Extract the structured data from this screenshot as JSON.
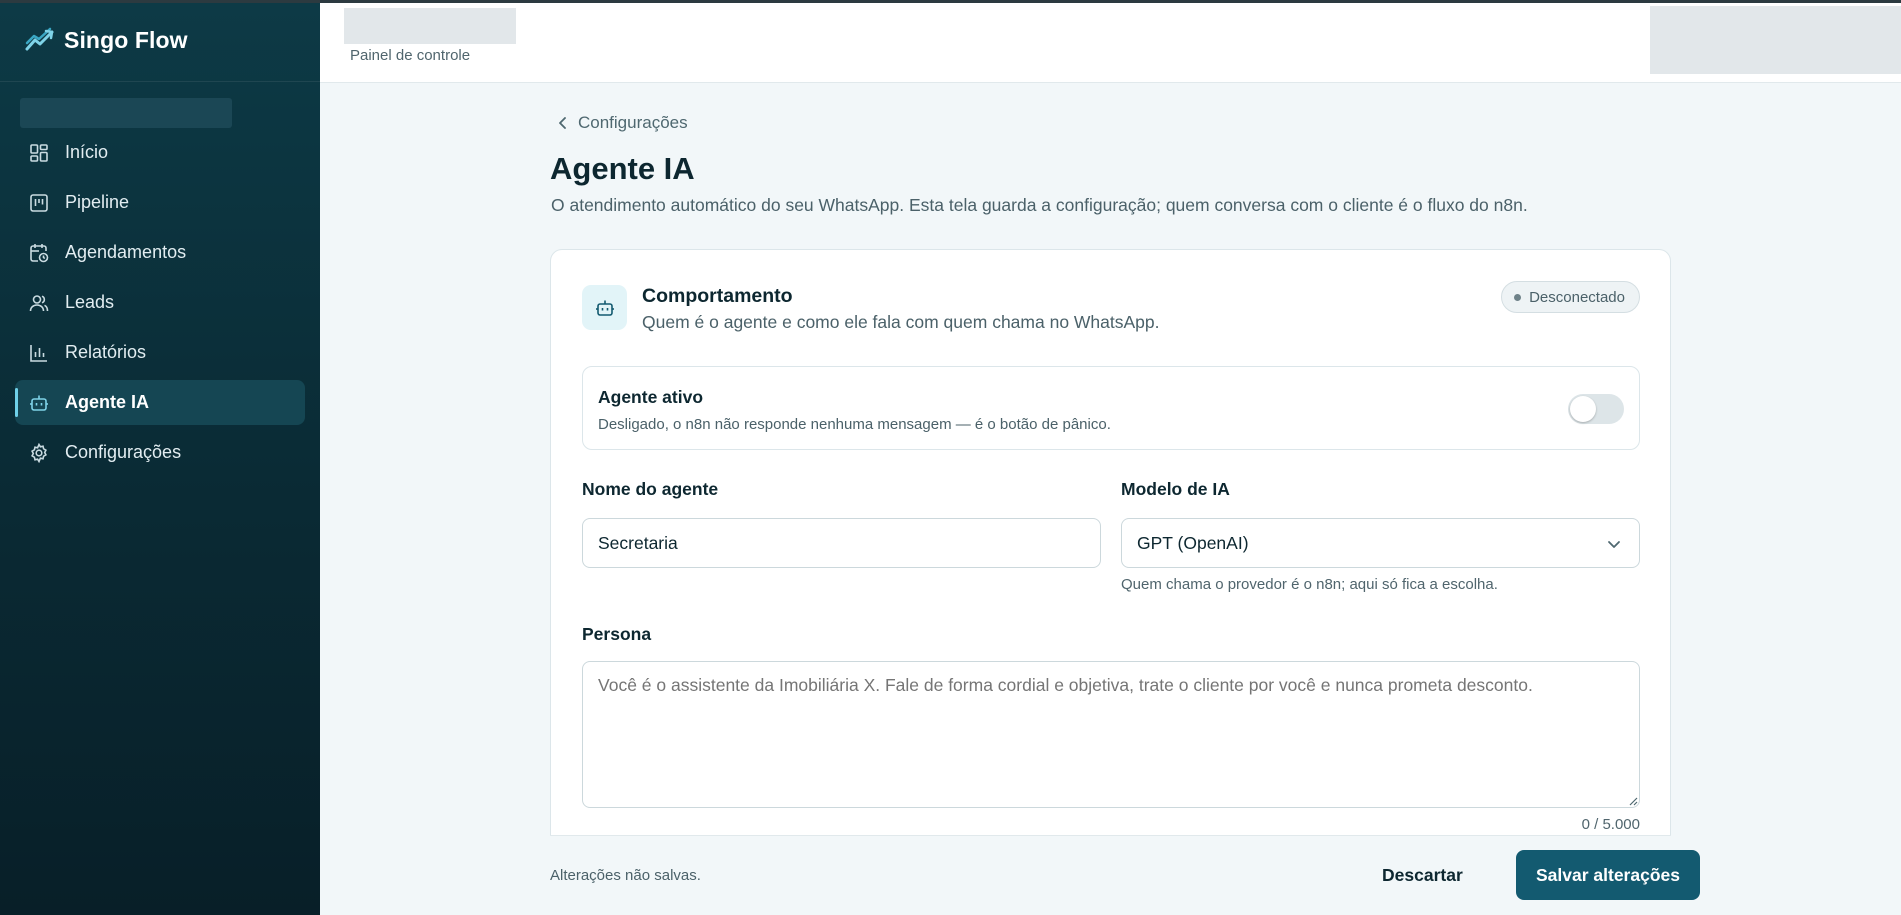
{
  "app": {
    "name": "Singo Flow"
  },
  "sidebar": {
    "items": [
      {
        "label": "Início",
        "icon": "dashboard-icon",
        "active": false
      },
      {
        "label": "Pipeline",
        "icon": "kanban-icon",
        "active": false
      },
      {
        "label": "Agendamentos",
        "icon": "calendar-clock-icon",
        "active": false
      },
      {
        "label": "Leads",
        "icon": "users-icon",
        "active": false
      },
      {
        "label": "Relatórios",
        "icon": "bar-chart-icon",
        "active": false
      },
      {
        "label": "Agente IA",
        "icon": "bot-icon",
        "active": true
      },
      {
        "label": "Configurações",
        "icon": "gear-icon",
        "active": false
      }
    ]
  },
  "header": {
    "subtitle": "Painel de controle"
  },
  "page": {
    "back_label": "Configurações",
    "title": "Agente IA",
    "description": "O atendimento automático do seu WhatsApp. Esta tela guarda a configuração; quem conversa com o cliente é o fluxo do n8n."
  },
  "card": {
    "title": "Comportamento",
    "subtitle": "Quem é o agente e como ele fala com quem chama no WhatsApp.",
    "status_badge": "Desconectado",
    "toggle": {
      "title": "Agente ativo",
      "description": "Desligado, o n8n não responde nenhuma mensagem — é o botão de pânico.",
      "enabled": false
    },
    "agent_name": {
      "label": "Nome do agente",
      "value": "Secretaria"
    },
    "model": {
      "label": "Modelo de IA",
      "selected": "GPT (OpenAI)",
      "helper": "Quem chama o provedor é o n8n; aqui só fica a escolha."
    },
    "persona": {
      "label": "Persona",
      "placeholder": "Você é o assistente da Imobiliária X. Fale de forma cordial e objetiva, trate o cliente por você e nunca prometa desconto.",
      "counter": "0 / 5.000"
    }
  },
  "footer": {
    "unsaved": "Alterações não salvas.",
    "discard_label": "Descartar",
    "save_label": "Salvar alterações"
  },
  "colors": {
    "sidebar_bg": "#0a2a34",
    "accent": "#135a70",
    "active_nav": "#154653",
    "badge_bg": "#eef3f5"
  }
}
